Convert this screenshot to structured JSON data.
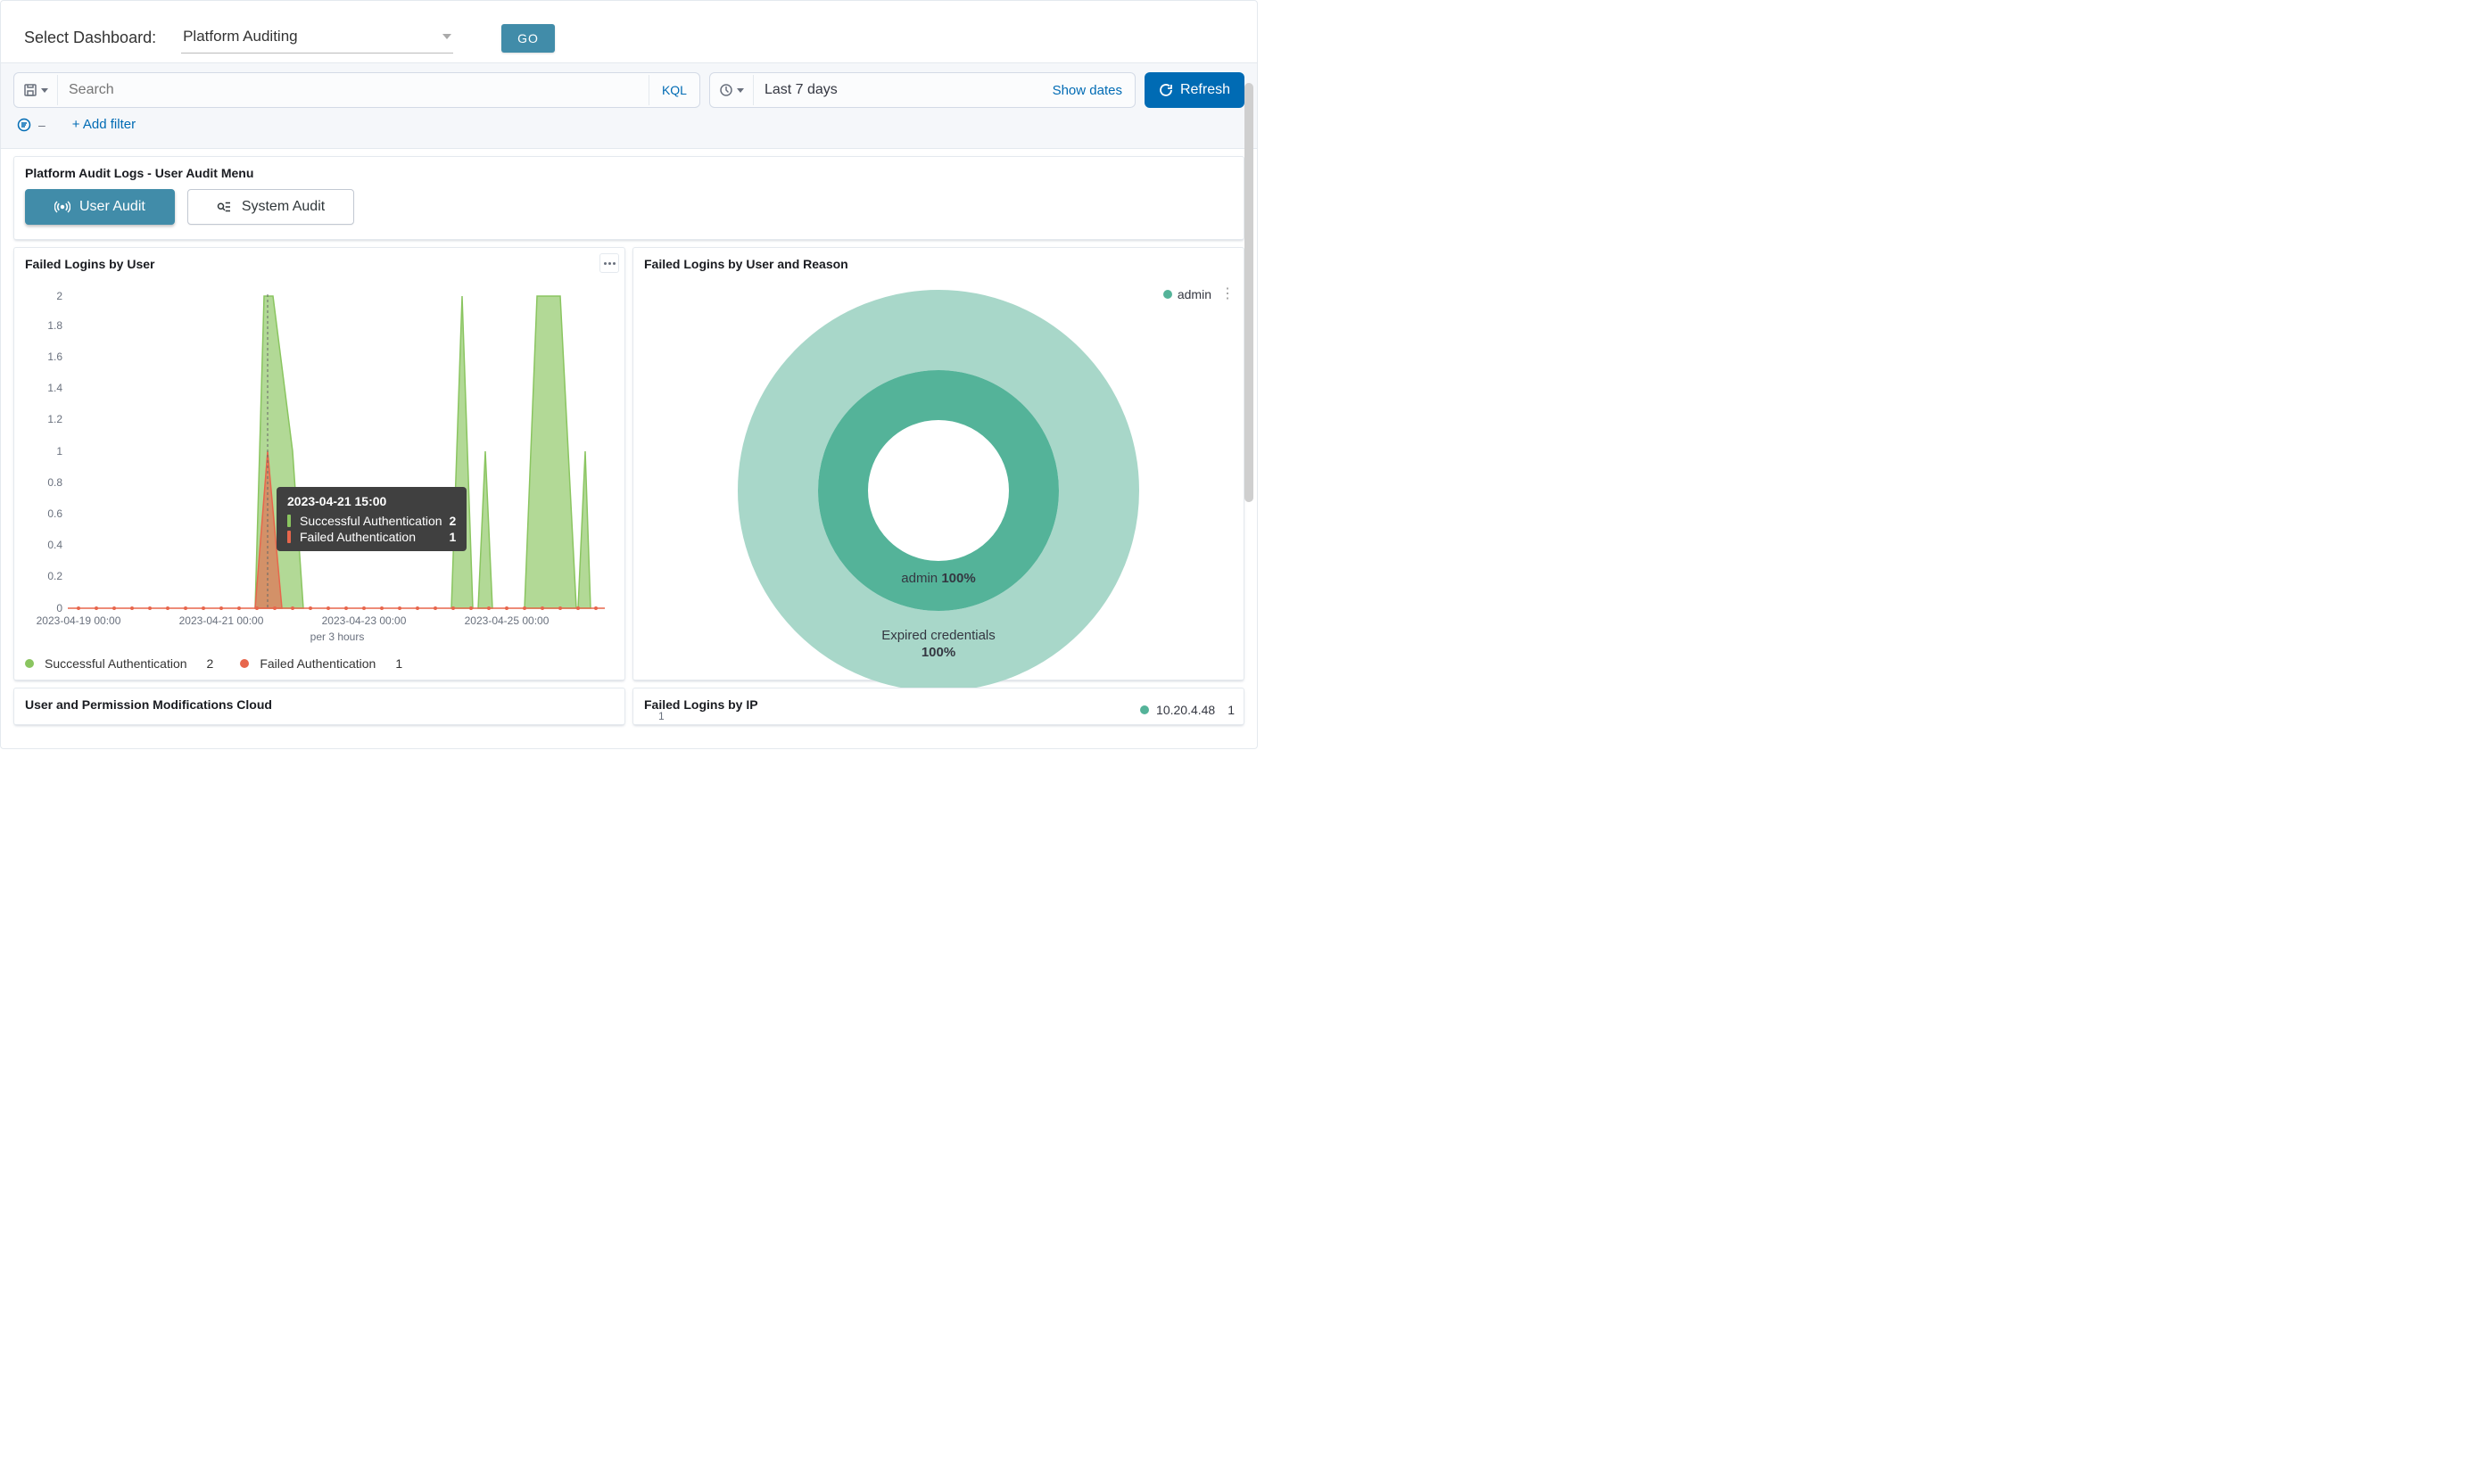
{
  "header": {
    "select_label": "Select Dashboard:",
    "selected": "Platform Auditing",
    "go_label": "GO"
  },
  "querybar": {
    "search_placeholder": "Search",
    "kql_label": "KQL",
    "date_text": "Last 7 days",
    "show_dates_label": "Show dates",
    "refresh_label": "Refresh",
    "add_filter_label": "+ Add filter"
  },
  "menu_panel": {
    "title": "Platform Audit Logs - User Audit Menu",
    "user_audit_label": "User Audit",
    "system_audit_label": "System Audit"
  },
  "panel_titles": {
    "failed_logins_by_user": "Failed Logins by User",
    "failed_logins_by_user_and_reason": "Failed Logins by User and Reason",
    "user_permission_modifications": "User and Permission Modifications Cloud",
    "failed_logins_by_ip": "Failed Logins by IP"
  },
  "colors": {
    "success_green": "#8ac560",
    "failed_red": "#e7664c",
    "teal_inner": "#54b399",
    "teal_outer": "#a8d7c9",
    "primary_blue": "#006bb4",
    "steel_blue": "#418ca9"
  },
  "line_chart": {
    "x_label": "per 3 hours",
    "y_ticks": [
      "0",
      "0.2",
      "0.4",
      "0.6",
      "0.8",
      "1",
      "1.2",
      "1.4",
      "1.6",
      "1.8",
      "2"
    ],
    "x_ticks": [
      "2023-04-19 00:00",
      "2023-04-21 00:00",
      "2023-04-23 00:00",
      "2023-04-25 00:00"
    ],
    "legend": {
      "success_label": "Successful Authentication",
      "success_value": "2",
      "failed_label": "Failed Authentication",
      "failed_value": "1"
    },
    "tooltip": {
      "title": "2023-04-21 15:00",
      "rows": [
        {
          "color": "#8ac560",
          "label": "Successful Authentication",
          "value": "2"
        },
        {
          "color": "#e7664c",
          "label": "Failed Authentication",
          "value": "1"
        }
      ]
    }
  },
  "donut": {
    "inner_label": "admin",
    "inner_value": "100%",
    "outer_label": "Expired credentials",
    "outer_value": "100%",
    "legend_label": "admin"
  },
  "ip_panel": {
    "legend_ip": "10.20.4.48",
    "legend_value": "1",
    "y_tick": "1"
  },
  "chart_data": [
    {
      "type": "area",
      "title": "Failed Logins by User",
      "xlabel": "per 3 hours",
      "ylabel": "",
      "ylim": [
        0,
        2
      ],
      "x_ticks": [
        "2023-04-19 00:00",
        "2023-04-21 00:00",
        "2023-04-23 00:00",
        "2023-04-25 00:00"
      ],
      "bucket_hours": 3,
      "series": [
        {
          "name": "Successful Authentication",
          "color": "#8ac560",
          "points": [
            {
              "x": "2023-04-21 12:00",
              "y": 2
            },
            {
              "x": "2023-04-21 15:00",
              "y": 2
            },
            {
              "x": "2023-04-21 18:00",
              "y": 1
            },
            {
              "x": "2023-04-24 00:00",
              "y": 2
            },
            {
              "x": "2023-04-24 09:00",
              "y": 1
            },
            {
              "x": "2023-04-25 06:00",
              "y": 2
            },
            {
              "x": "2023-04-25 09:00",
              "y": 2
            },
            {
              "x": "2023-04-25 21:00",
              "y": 1
            }
          ]
        },
        {
          "name": "Failed Authentication",
          "color": "#e7664c",
          "points": [
            {
              "x": "2023-04-21 15:00",
              "y": 1
            }
          ]
        }
      ],
      "tooltip": {
        "x": "2023-04-21 15:00",
        "rows": [
          {
            "series": "Successful Authentication",
            "value": 2
          },
          {
            "series": "Failed Authentication",
            "value": 1
          }
        ]
      }
    },
    {
      "type": "pie",
      "title": "Failed Logins by User and Reason",
      "rings": [
        {
          "level": "user",
          "slices": [
            {
              "label": "admin",
              "value": 100
            }
          ]
        },
        {
          "level": "reason",
          "slices": [
            {
              "label": "Expired credentials",
              "value": 100
            }
          ]
        }
      ]
    },
    {
      "type": "bar",
      "title": "Failed Logins by IP",
      "ylim": [
        0,
        1
      ],
      "series": [
        {
          "name": "10.20.4.48",
          "color": "#54b399",
          "values": [
            1
          ]
        }
      ]
    }
  ]
}
